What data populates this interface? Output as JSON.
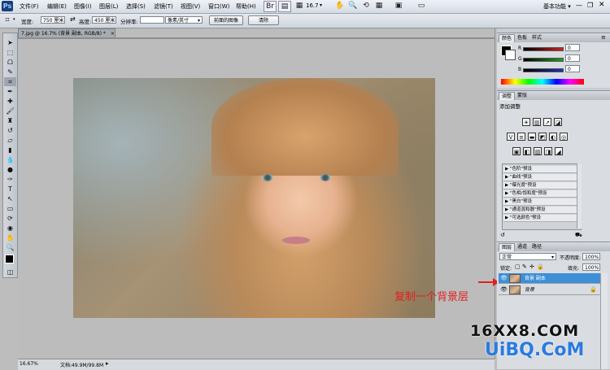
{
  "app": {
    "logo": "Ps",
    "workspace": "基本功能 ▾"
  },
  "menu": [
    "文件(F)",
    "编辑(E)",
    "图像(I)",
    "图层(L)",
    "选择(S)",
    "滤镜(T)",
    "视图(V)",
    "窗口(W)",
    "帮助(H)"
  ],
  "topbar": {
    "zoom": "16.7",
    "zoom_arrow": "▾"
  },
  "options": {
    "width_label": "宽度:",
    "width_value": "750 厘米",
    "swap_icon": "⇄",
    "height_label": "高度:",
    "height_value": "450 厘米",
    "res_label": "分辨率:",
    "res_value": "",
    "unit_value": "像素/英寸",
    "front_image_label": "前面的图像",
    "clear_label": "清除"
  },
  "document": {
    "tab_title": "7.jpg @ 16.7% (背景 副本, RGB/8) *",
    "close": "×"
  },
  "status": {
    "zoom": "16.67%",
    "doc_info": "文档:49.9M/99.8M"
  },
  "annotation": {
    "text": "复制一个背景层"
  },
  "panels": {
    "color": {
      "tabs": [
        "颜色",
        "色板",
        "样式"
      ],
      "channels": [
        {
          "label": "R",
          "value": "0",
          "color": "#d02020"
        },
        {
          "label": "G",
          "value": "0",
          "color": "#20a020"
        },
        {
          "label": "B",
          "value": "0",
          "color": "#2030c0"
        }
      ]
    },
    "adjust": {
      "tabs": [
        "调整",
        "蒙版"
      ],
      "title": "添加调整",
      "icons_row1": [
        "☀",
        "▥",
        "↗",
        "◪"
      ],
      "icons_row2": [
        "V",
        "≡",
        "▬",
        "◩",
        "◐",
        "◎"
      ],
      "icons_row3": [
        "▣",
        "◧",
        "▨",
        "◨",
        "◢"
      ],
      "presets": [
        "\"色阶\"预设",
        "\"曲线\"预设",
        "\"曝光度\"预设",
        "\"色相/饱和度\"预设",
        "\"黑白\"预设",
        "\"通道混和器\"预设",
        "\"可选颜色\"预设"
      ]
    },
    "layers": {
      "tabs": [
        "图层",
        "通道",
        "路径"
      ],
      "blend_mode": "正常",
      "opacity_label": "不透明度:",
      "opacity_value": "100%",
      "lock_label": "锁定:",
      "fill_label": "填充:",
      "fill_value": "100%",
      "rows": [
        {
          "name": "背景 副本",
          "selected": true
        },
        {
          "name": "背景",
          "selected": false
        }
      ]
    }
  },
  "watermark": {
    "line1": "16XX8.COM",
    "line2": "UiBQ.CoM"
  },
  "colors": {
    "accent_selected_layer": "#3d8fd8",
    "annotation_red": "#e0211f"
  }
}
